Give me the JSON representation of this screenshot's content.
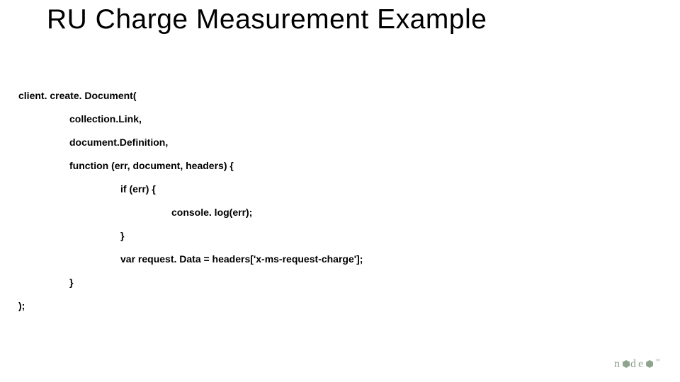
{
  "title": "RU Charge Measurement Example",
  "code": {
    "l0": "client. create. Document(",
    "l1": "collection.Link,",
    "l2": "document.Definition,",
    "l3": "function (err, document, headers) {",
    "l4": "if (err) {",
    "l5": "console. log(err);",
    "l6": "}",
    "l7": "var request. Data = headers['x-ms-request-charge'];",
    "l8": "}",
    "l9": ");"
  },
  "logo": {
    "text_a": "n",
    "text_b": "de",
    "tm": "™"
  }
}
